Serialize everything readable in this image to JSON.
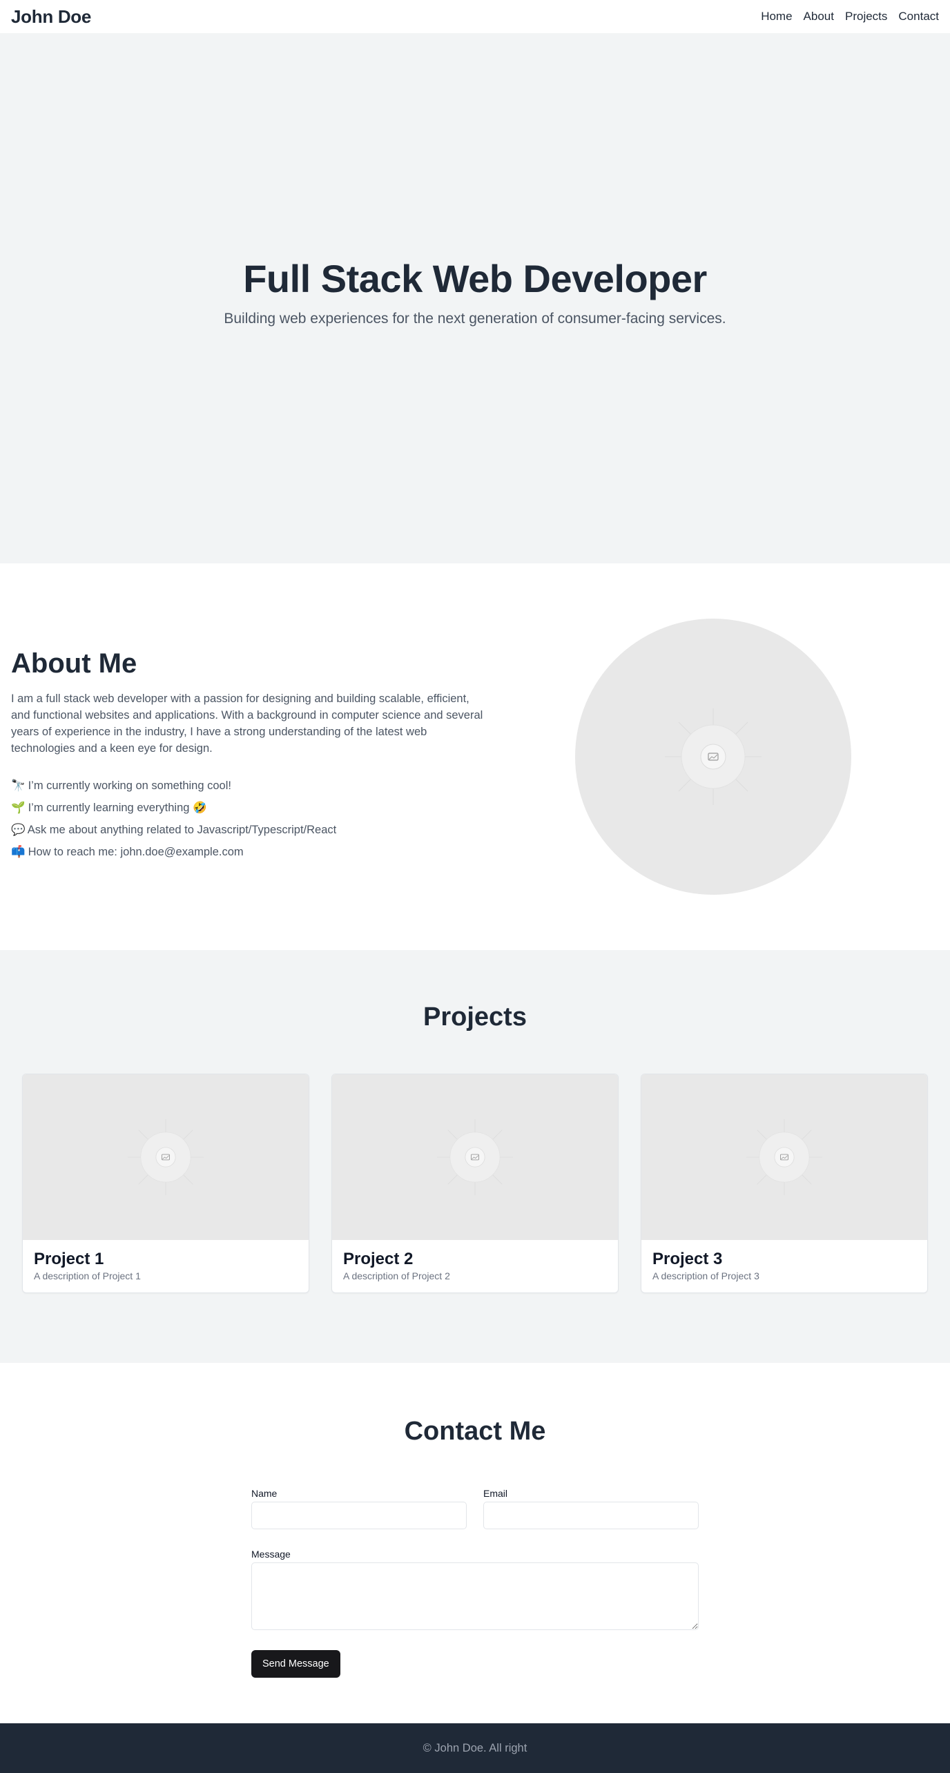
{
  "header": {
    "brand": "John Doe",
    "nav": [
      {
        "label": "Home"
      },
      {
        "label": "About"
      },
      {
        "label": "Projects"
      },
      {
        "label": "Contact"
      }
    ]
  },
  "hero": {
    "title": "Full Stack Web Developer",
    "subtitle": "Building web experiences for the next generation of consumer-facing services."
  },
  "about": {
    "title": "About Me",
    "bio": "I am a full stack web developer with a passion for designing and building scalable, efficient, and functional websites and applications. With a background in computer science and several years of experience in the industry, I have a strong understanding of the latest web technologies and a keen eye for design.",
    "facts": [
      {
        "emoji": "🔭",
        "text": "I’m currently working on something cool!"
      },
      {
        "emoji": "🌱",
        "text": "I’m currently learning everything 🤣"
      },
      {
        "emoji": "💬",
        "text": "Ask me about anything related to Javascript/Typescript/React"
      },
      {
        "emoji": "📫",
        "text": "How to reach me: john.doe@example.com"
      }
    ],
    "image_icon": "image-placeholder-icon"
  },
  "projects": {
    "title": "Projects",
    "items": [
      {
        "title": "Project 1",
        "description": "A description of Project 1"
      },
      {
        "title": "Project 2",
        "description": "A description of Project 2"
      },
      {
        "title": "Project 3",
        "description": "A description of Project 3"
      }
    ]
  },
  "contact": {
    "title": "Contact Me",
    "name_label": "Name",
    "name_value": "",
    "email_label": "Email",
    "email_value": "",
    "message_label": "Message",
    "message_value": "",
    "submit_label": "Send Message"
  },
  "footer": {
    "text": "© John Doe. All right"
  },
  "colors": {
    "text_dark": "#1f2937",
    "muted": "#4b5563",
    "section_bg": "#f2f4f5",
    "placeholder_bg": "#e8e8e8",
    "button_bg": "#18181b",
    "footer_bg": "#1f2937"
  }
}
